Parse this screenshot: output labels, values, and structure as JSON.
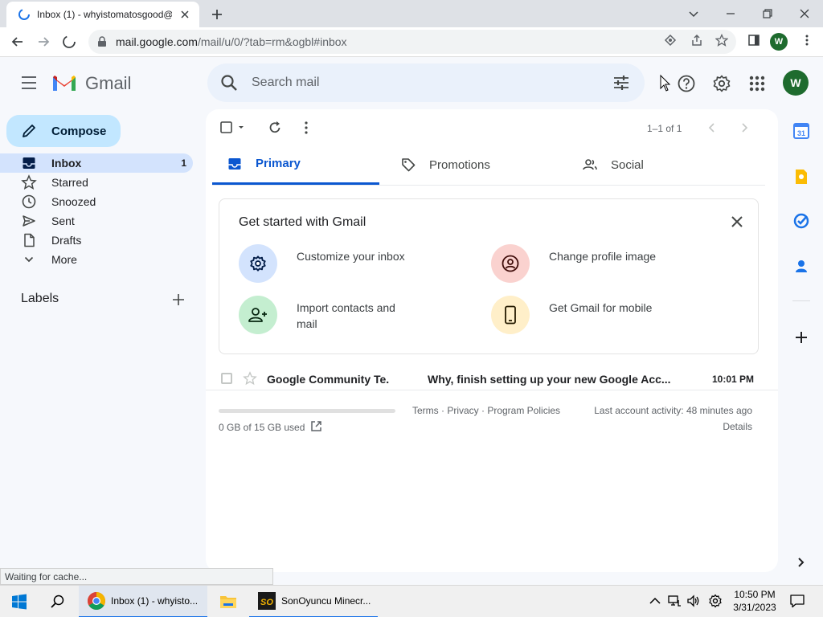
{
  "browser": {
    "tab_title": "Inbox (1) - whyistomatosgood@g",
    "url_host": "mail.google.com",
    "url_path": "/mail/u/0/?tab=rm&ogbl#inbox",
    "profile_initial": "W",
    "status_text": "Waiting for cache..."
  },
  "header": {
    "app_name": "Gmail",
    "search_placeholder": "Search mail",
    "avatar_initial": "W"
  },
  "compose": {
    "label": "Compose"
  },
  "nav": {
    "items": [
      {
        "label": "Inbox",
        "count": "1",
        "icon": "inbox-icon"
      },
      {
        "label": "Starred",
        "icon": "star-icon"
      },
      {
        "label": "Snoozed",
        "icon": "clock-icon"
      },
      {
        "label": "Sent",
        "icon": "send-icon"
      },
      {
        "label": "Drafts",
        "icon": "draft-icon"
      },
      {
        "label": "More",
        "icon": "chevron-down-icon"
      }
    ],
    "labels_heading": "Labels"
  },
  "toolbar": {
    "pagination": "1–1 of 1"
  },
  "tabs": [
    {
      "label": "Primary"
    },
    {
      "label": "Promotions"
    },
    {
      "label": "Social"
    }
  ],
  "card": {
    "title": "Get started with Gmail",
    "items": [
      {
        "label": "Customize your inbox",
        "icon": "gear-icon",
        "color": "#d3e3fd"
      },
      {
        "label": "Change profile image",
        "icon": "account-circle-icon",
        "color": "#fad2cf"
      },
      {
        "label": "Import contacts and mail",
        "icon": "person-add-icon",
        "color": "#c4eed0"
      },
      {
        "label": "Get Gmail for mobile",
        "icon": "phone-icon",
        "color": "#ffefc9"
      }
    ]
  },
  "emails": [
    {
      "sender": "Google Community Te.",
      "subject": "Why, finish setting up your new Google Acc...",
      "time": "10:01 PM"
    }
  ],
  "footer": {
    "storage": "0 GB of 15 GB used",
    "links": "Terms · Privacy · Program Policies",
    "last_activity": "Last account activity: 48 minutes ago",
    "details": "Details"
  },
  "taskbar": {
    "apps": [
      {
        "label": "Inbox (1) - whyisto..."
      },
      {
        "label": "SonOyuncu Minecr..."
      }
    ],
    "time": "10:50 PM",
    "date": "3/31/2023"
  }
}
